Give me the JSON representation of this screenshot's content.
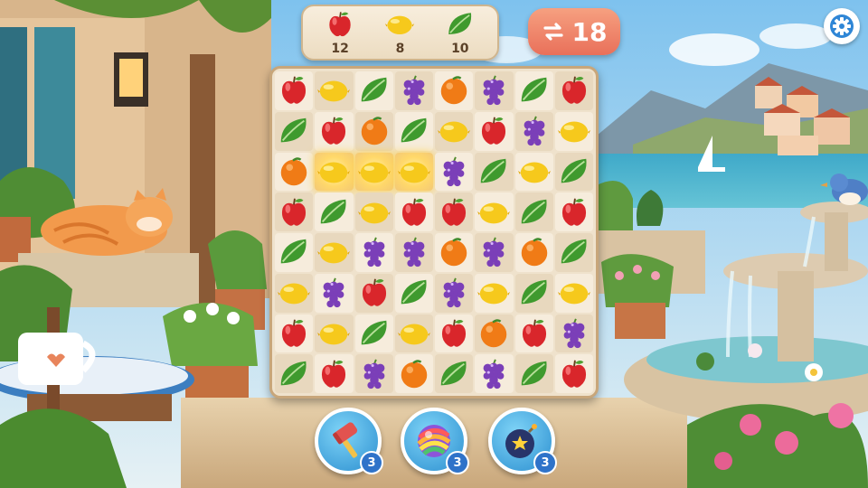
{
  "goals": [
    {
      "icon": "apple-icon",
      "count": "12"
    },
    {
      "icon": "lemon-icon",
      "count": "8"
    },
    {
      "icon": "leaf-icon",
      "count": "10"
    }
  ],
  "moves": {
    "icon": "swap-arrows-icon",
    "value": "18"
  },
  "settings": {
    "icon": "gear-icon"
  },
  "board": {
    "rows": [
      [
        "apple",
        "lemon",
        "leaf",
        "grape",
        "orange",
        "grape",
        "leaf",
        "apple"
      ],
      [
        "leaf",
        "apple",
        "orange",
        "leaf",
        "lemon",
        "apple",
        "grape",
        "lemon"
      ],
      [
        "orange",
        "lemon",
        "lemon",
        "lemon",
        "grape",
        "leaf",
        "lemon",
        "leaf"
      ],
      [
        "apple",
        "leaf",
        "lemon",
        "apple",
        "apple",
        "lemon",
        "leaf",
        "apple"
      ],
      [
        "leaf",
        "lemon",
        "grape",
        "grape",
        "orange",
        "grape",
        "orange",
        "leaf"
      ],
      [
        "lemon",
        "grape",
        "apple",
        "leaf",
        "grape",
        "lemon",
        "leaf",
        "lemon"
      ],
      [
        "apple",
        "lemon",
        "leaf",
        "lemon",
        "apple",
        "orange",
        "apple",
        "grape"
      ],
      [
        "leaf",
        "apple",
        "grape",
        "orange",
        "leaf",
        "grape",
        "leaf",
        "apple"
      ]
    ],
    "highlighted": [
      [
        2,
        1
      ],
      [
        2,
        2
      ],
      [
        2,
        3
      ]
    ]
  },
  "boosters": [
    {
      "name": "hammer",
      "icon": "hammer-icon",
      "count": "3"
    },
    {
      "name": "rainbow-ball",
      "icon": "rainbow-ball-icon",
      "count": "3"
    },
    {
      "name": "bomb",
      "icon": "bomb-icon",
      "count": "3"
    }
  ],
  "colors": {
    "apple": "#d9262b",
    "lemon": "#f6c91c",
    "leaf": "#3f9a2e",
    "grape": "#7b3fb8",
    "orange": "#f07b16",
    "moves_pill": "#ec7a60",
    "booster": "#2c8fd0"
  }
}
